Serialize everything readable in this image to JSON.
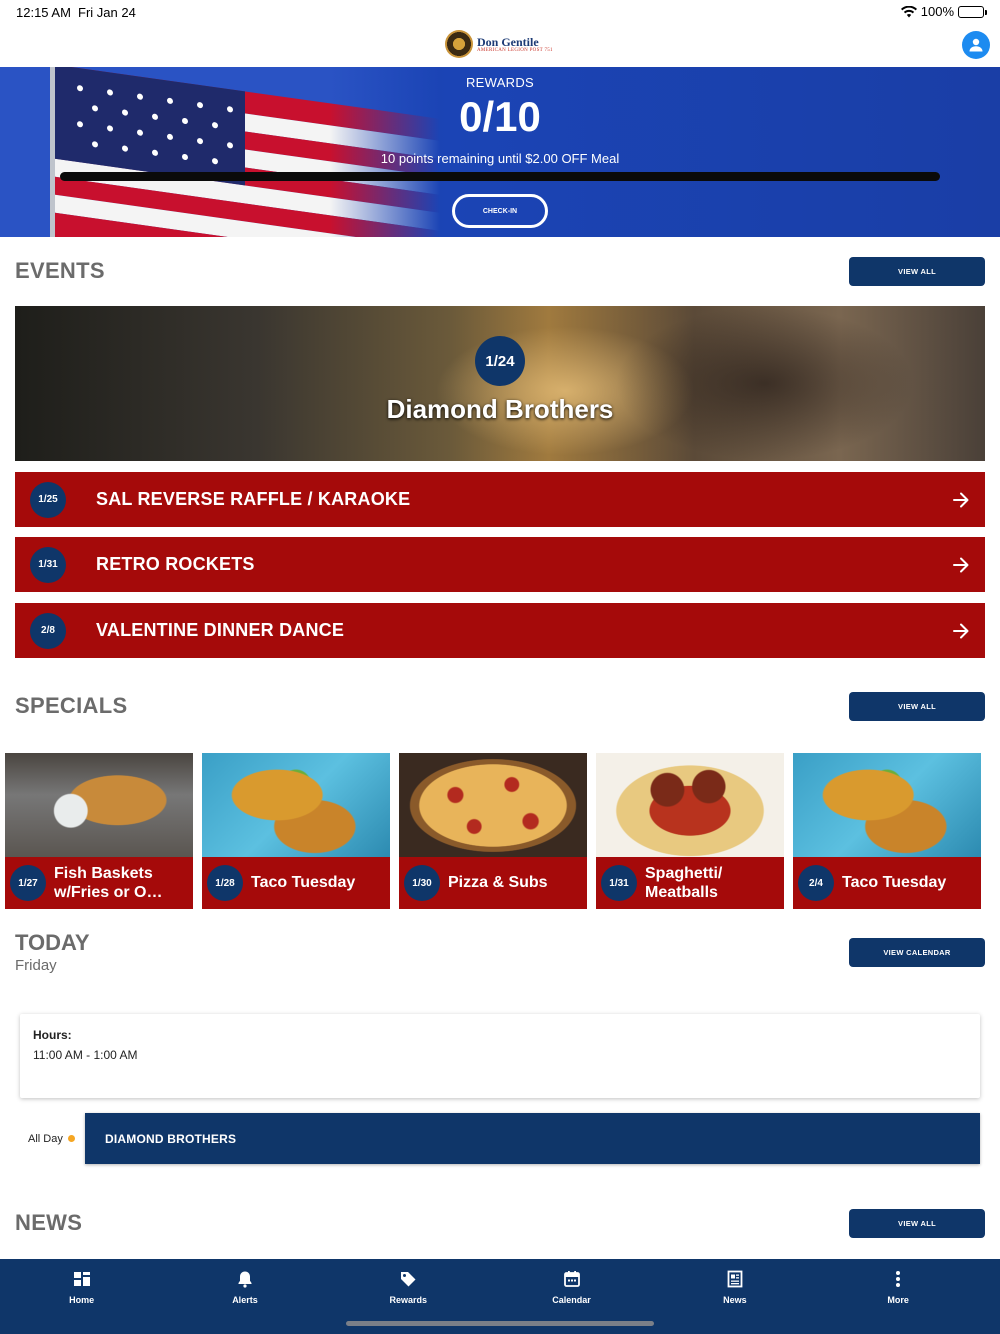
{
  "status_bar": {
    "time": "12:15 AM",
    "date": "Fri Jan 24",
    "battery": "100%"
  },
  "header": {
    "logo_name": "Don Gentile",
    "logo_sub": "AMERICAN LEGION POST 751"
  },
  "rewards": {
    "label": "REWARDS",
    "count": "0/10",
    "message": "10 points remaining until $2.00 OFF Meal",
    "progress_fraction": 0,
    "checkin_label": "CHECK-IN"
  },
  "events": {
    "title": "EVENTS",
    "view_all": "VIEW ALL",
    "featured": {
      "date": "1/24",
      "title": "Diamond Brothers"
    },
    "items": [
      {
        "date": "1/25",
        "title": "SAL REVERSE RAFFLE / KARAOKE"
      },
      {
        "date": "1/31",
        "title": "RETRO ROCKETS"
      },
      {
        "date": "2/8",
        "title": "VALENTINE DINNER DANCE"
      }
    ]
  },
  "specials": {
    "title": "SPECIALS",
    "view_all": "VIEW ALL",
    "items": [
      {
        "date": "1/27",
        "title": "Fish Baskets w/Fries or O…",
        "image": "fish"
      },
      {
        "date": "1/28",
        "title": "Taco Tuesday",
        "image": "taco"
      },
      {
        "date": "1/30",
        "title": "Pizza & Subs",
        "image": "pizza"
      },
      {
        "date": "1/31",
        "title": "Spaghetti/ Meatballs",
        "image": "spag"
      },
      {
        "date": "2/4",
        "title": "Taco Tuesday",
        "image": "taco"
      }
    ]
  },
  "today": {
    "title": "TODAY",
    "day": "Friday",
    "view_calendar": "VIEW CALENDAR",
    "hours_label": "Hours:",
    "hours_value": "11:00 AM - 1:00 AM",
    "all_day_label": "All Day",
    "event": "DIAMOND BROTHERS"
  },
  "news": {
    "title": "NEWS",
    "view_all": "VIEW ALL"
  },
  "tabs": [
    {
      "label": "Home",
      "icon": "dashboard-icon"
    },
    {
      "label": "Alerts",
      "icon": "bell-icon"
    },
    {
      "label": "Rewards",
      "icon": "tag-icon"
    },
    {
      "label": "Calendar",
      "icon": "calendar-icon"
    },
    {
      "label": "News",
      "icon": "newspaper-icon"
    },
    {
      "label": "More",
      "icon": "more-vertical-icon"
    }
  ],
  "colors": {
    "navy": "#0f3669",
    "red": "#a50a0a",
    "banner_blue": "#1b44b5",
    "progress_fill": "#f5b42a"
  }
}
